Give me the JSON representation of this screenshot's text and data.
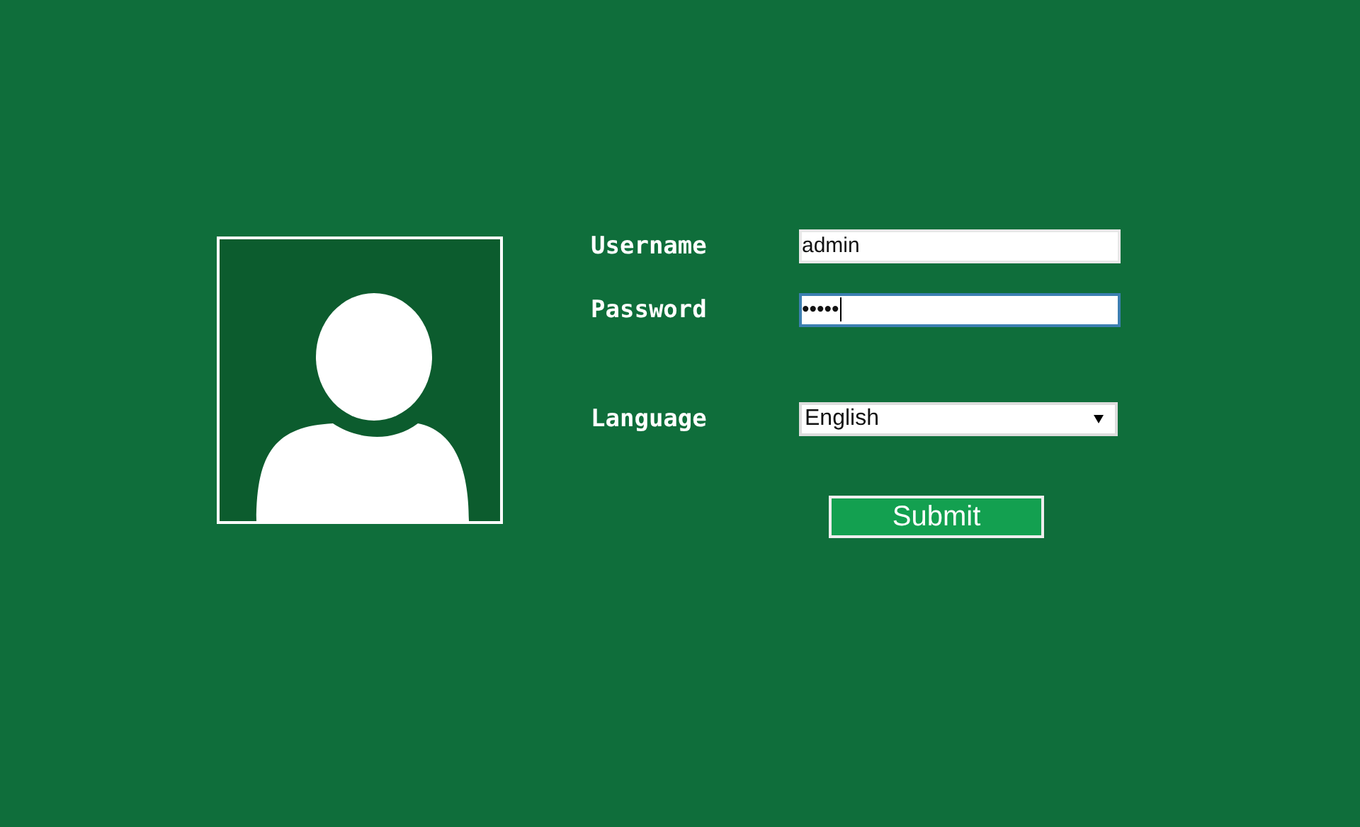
{
  "fields": [
    {
      "label": "Username",
      "value": "admin",
      "focused": false
    },
    {
      "label": "Password",
      "value": "•••••",
      "focused": true
    }
  ],
  "language": {
    "label": "Language",
    "value": "English"
  },
  "submit": "Submit"
}
